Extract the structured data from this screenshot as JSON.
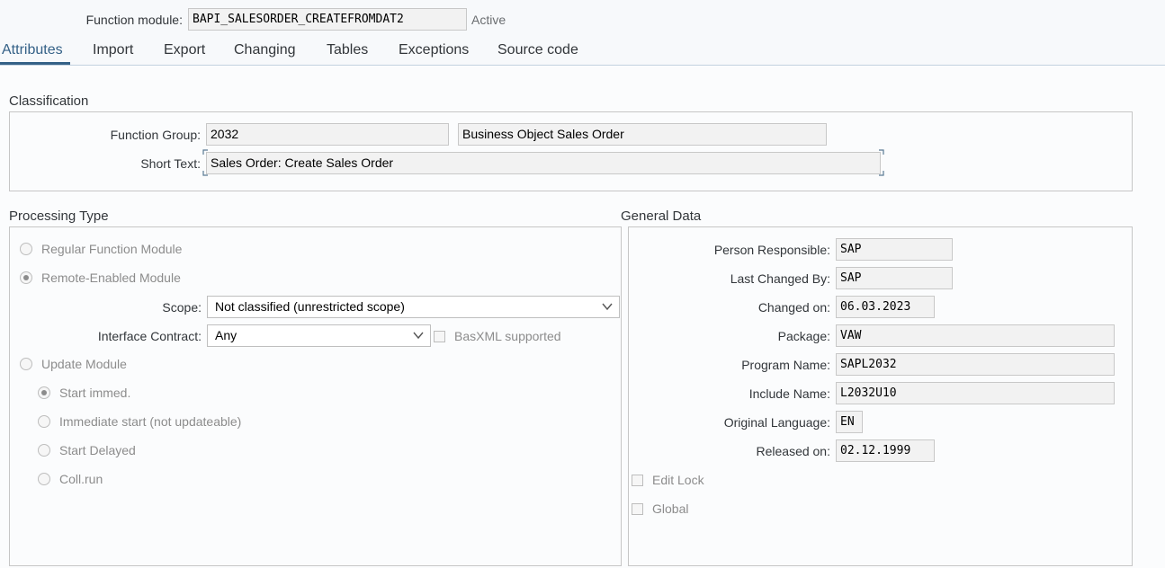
{
  "header": {
    "fm_label": "Function module:",
    "fm_value": "BAPI_SALESORDER_CREATEFROMDAT2",
    "status": "Active"
  },
  "tabs": [
    "Attributes",
    "Import",
    "Export",
    "Changing",
    "Tables",
    "Exceptions",
    "Source code"
  ],
  "classification": {
    "title": "Classification",
    "function_group_label": "Function Group:",
    "function_group_value": "2032",
    "function_group_text": "Business Object Sales Order",
    "short_text_label": "Short Text:",
    "short_text_value": "Sales Order: Create Sales Order"
  },
  "processing": {
    "title": "Processing Type",
    "regular": "Regular Function Module",
    "remote": "Remote-Enabled Module",
    "scope_label": "Scope:",
    "scope_value": "Not classified (unrestricted scope)",
    "interface_label": "Interface Contract:",
    "interface_value": "Any",
    "basxml": "BasXML supported",
    "update": "Update Module",
    "start_immed": "Start immed.",
    "immediate_not_upd": "Immediate start (not updateable)",
    "start_delayed": "Start Delayed",
    "coll_run": "Coll.run"
  },
  "general": {
    "title": "General Data",
    "person_label": "Person Responsible:",
    "person_value": "SAP",
    "lastby_label": "Last Changed By:",
    "lastby_value": "SAP",
    "changed_label": "Changed on:",
    "changed_value": "06.03.2023",
    "package_label": "Package:",
    "package_value": "VAW",
    "program_label": "Program Name:",
    "program_value": "SAPL2032",
    "include_label": "Include Name:",
    "include_value": "L2032U10",
    "lang_label": "Original Language:",
    "lang_value": "EN",
    "released_label": "Released on:",
    "released_value": "02.12.1999",
    "edit_lock": "Edit Lock",
    "global": "Global"
  },
  "colors": {
    "accent": "#346187",
    "background": "#f7f9fb",
    "field_bg": "#f2f2f2",
    "border": "#c6c6c6"
  }
}
